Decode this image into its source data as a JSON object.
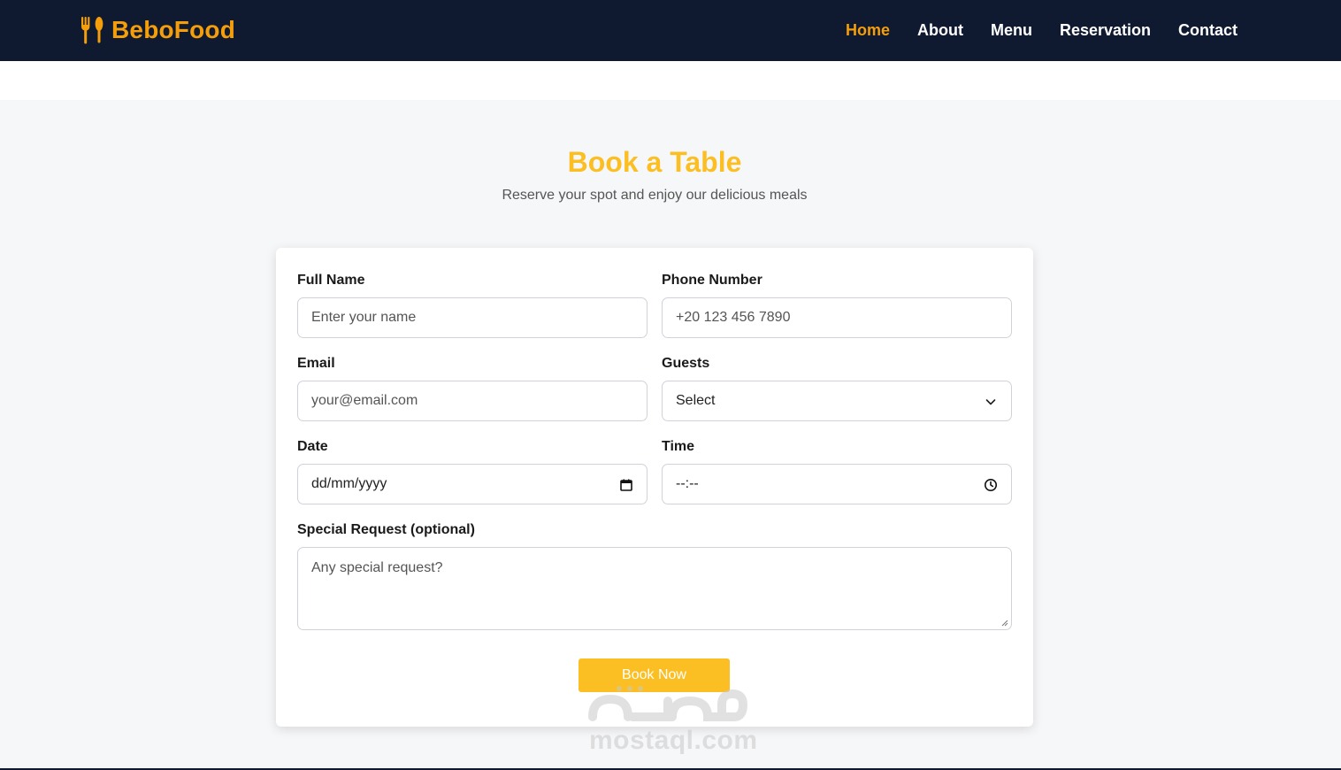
{
  "brand": {
    "name": "BeboFood",
    "icon": "fork-spoon-icon",
    "color": "#f59e0b"
  },
  "nav": {
    "active_color": "#f59e0b",
    "items": [
      {
        "label": "Home",
        "active": true
      },
      {
        "label": "About",
        "active": false
      },
      {
        "label": "Menu",
        "active": false
      },
      {
        "label": "Reservation",
        "active": false
      },
      {
        "label": "Contact",
        "active": false
      }
    ]
  },
  "section": {
    "title": "Book a Table",
    "title_color": "#fbbf24",
    "subtitle": "Reserve your spot and enjoy our delicious meals"
  },
  "form": {
    "full_name": {
      "label": "Full Name",
      "placeholder": "Enter your name",
      "value": ""
    },
    "phone": {
      "label": "Phone Number",
      "placeholder": "+20 123 456 7890",
      "value": ""
    },
    "email": {
      "label": "Email",
      "placeholder": "your@email.com",
      "value": ""
    },
    "guests": {
      "label": "Guests",
      "selected": "Select",
      "icon": "chevron-down-icon"
    },
    "date": {
      "label": "Date",
      "display": "dd/mm/yyyy",
      "icon": "calendar-icon"
    },
    "time": {
      "label": "Time",
      "display": "--:--",
      "icon": "clock-icon"
    },
    "special_request": {
      "label": "Special Request (optional)",
      "placeholder": "Any special request?"
    },
    "submit": {
      "label": "Book Now",
      "color": "#fbbf24"
    }
  },
  "watermark": {
    "text": "mostaql.com"
  }
}
